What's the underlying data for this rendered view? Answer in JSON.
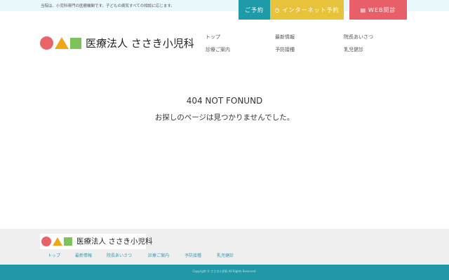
{
  "header": {
    "tagline": "当院は、小児科専門の医療機関です。子どもの病気すべての相談に応じます。",
    "buttons": [
      {
        "label": "ご予約"
      },
      {
        "label": "インターネット予約"
      },
      {
        "label": "WEB問診"
      }
    ],
    "logo_text": "医療法人 ささき小児科",
    "nav": [
      "トップ",
      "最新情報",
      "院長あいさつ",
      "診療ご案内",
      "予防接種",
      "乳児健診"
    ]
  },
  "main": {
    "error_title": "404 NOT FONUND",
    "error_message": "お探しのページは見つかりませんでした。"
  },
  "footer": {
    "logo_text": "医療法人 ささき小児科",
    "nav": [
      "トップ",
      "最新情報",
      "院長あいさつ",
      "診療ご案内",
      "予防接種",
      "乳児健診"
    ],
    "copyright": "Copyright © ささき小児科 All Rights Reserved."
  },
  "colors": {
    "teal": "#1e9aa8",
    "yellow": "#e6c33b",
    "red": "#e85f69"
  }
}
